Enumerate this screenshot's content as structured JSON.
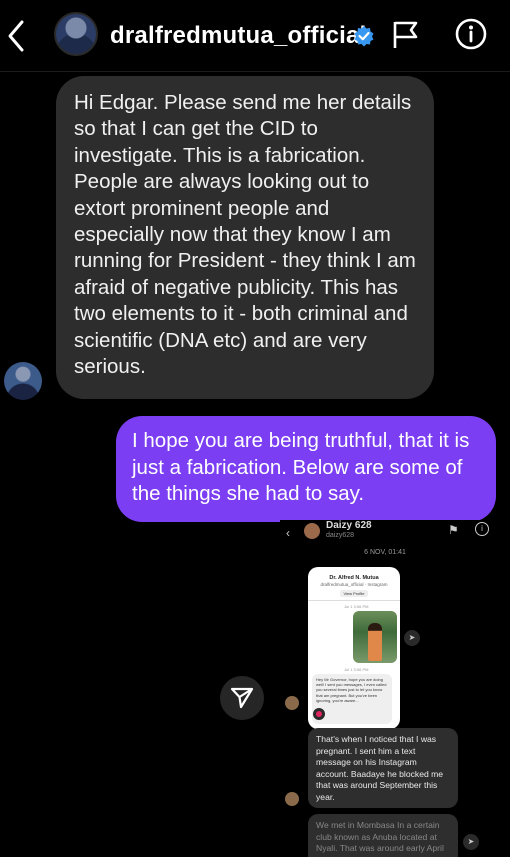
{
  "header": {
    "username": "dralfredmutua_official",
    "back_icon": "chevron-left-icon",
    "verified_icon": "verified-badge-icon",
    "verified_color": "#3897f0",
    "flag_icon": "flag-icon",
    "info_icon": "info-icon"
  },
  "messages": {
    "incoming_text": "Hi Edgar. Please send me her details so that I can get the CID to investigate. This is a fabrication. People are always looking out to extort prominent people and especially now that they know I am running for President - they think I am afraid of negative publicity. This has two elements to it - both criminal and scientific (DNA etc) and are very serious.",
    "outgoing_text": "I hope you are being truthful, that it is just a fabrication. Below are some of the things she had to say.",
    "incoming_bubble_color": "#2d2d2d",
    "outgoing_bubble_color": "#7b3ef2"
  },
  "embedded": {
    "name": "Daizy 628",
    "handle": "daizy628",
    "date": "6 NOV, 01:41",
    "card": {
      "profile_name": "Dr. Alfred N. Mutua",
      "profile_sub": "dralfredmutua_official · Instagram",
      "button": "View Profile",
      "time1": "Jul 1 3:56 PM",
      "time2": "Jul 1 3:56 PM",
      "message": "Hey Mr Governor, hope you are doing well! I sent you messages, I even called you several times just to let you know that am pregnant. But you've been ignoring, you're aware..."
    },
    "bubble1": "That's when I noticed that I was pregnant. I sent him a text message on his Instagram account. Baadaye he blocked me that was around September this year.",
    "bubble2": "We met in Mombasa In a certain club known as Anuba located at Nyali. That was around early April"
  },
  "share_icon": "paper-plane-icon"
}
